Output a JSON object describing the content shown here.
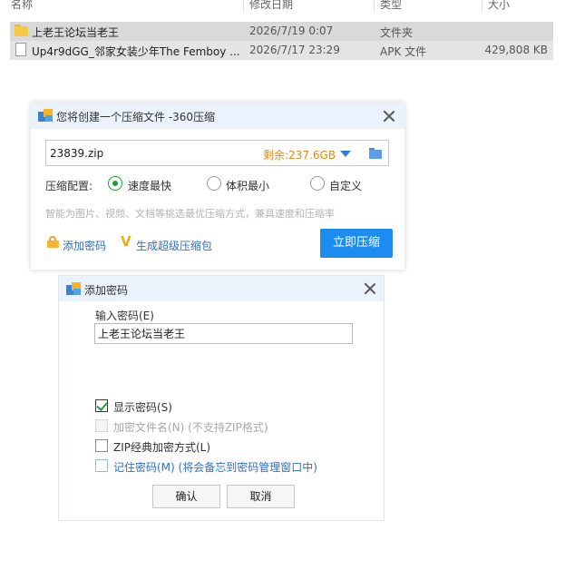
{
  "file_list": {
    "columns": [
      "名称",
      "修改日期",
      "类型",
      "大小"
    ],
    "rows": [
      {
        "name": "上老王论坛当老王",
        "date": "2026/7/19 0:07",
        "type": "文件夹",
        "size": "",
        "icon": "folder-icon"
      },
      {
        "name": "Up4r9dGG_邻家女装少年The Femboy ...",
        "date": "2026/7/17 23:29",
        "type": "APK 文件",
        "size": "429,808 KB",
        "icon": "file-icon"
      }
    ]
  },
  "compress_dialog": {
    "title": "您将创建一个压缩文件 -360压缩",
    "filename": "23839.zip",
    "free_space": "剩余:237.6GB",
    "config_label": "压缩配置:",
    "options": [
      "速度最快",
      "体积最小",
      "自定义"
    ],
    "selected_option": "速度最快",
    "hint": "智能为图片、视频、文档等挑选最优压缩方式，兼具速度和压缩率",
    "add_password_link": "添加密码",
    "super_pack_link": "生成超级压缩包",
    "compress_now_button": "立即压缩"
  },
  "password_dialog": {
    "title": "添加密码",
    "input_label": "输入密码(E)",
    "password_value": "上老王论坛当老王",
    "checkboxes": [
      {
        "label": "显示密码(S)",
        "checked": true,
        "enabled": true
      },
      {
        "label": "加密文件名(N) (不支持ZIP格式)",
        "checked": false,
        "enabled": false
      },
      {
        "label": "ZIP经典加密方式(L)",
        "checked": false,
        "enabled": true
      },
      {
        "label": "记住密码(M) (将会备忘到密码管理窗口中)",
        "checked": false,
        "enabled": true
      }
    ],
    "ok_button": "确认",
    "cancel_button": "取消"
  },
  "colors": {
    "accent_blue": "#1d8cf0",
    "title_bar_bg": "#eaf3fc",
    "free_space_orange": "#e88a10",
    "radio_green": "#1a9d3c",
    "link_blue": "#2f6fc7"
  }
}
